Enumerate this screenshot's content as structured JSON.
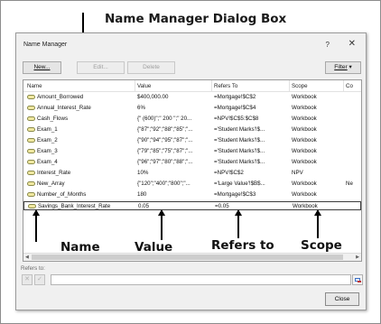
{
  "header_label": "Name Manager Dialog Box",
  "dialog": {
    "title": "Name Manager",
    "help_glyph": "?",
    "close_glyph": "✕",
    "buttons": {
      "new": "New...",
      "edit": "Edit...",
      "delete": "Delete",
      "filter": "Filter",
      "filter_caret": "▾"
    },
    "columns": [
      "Name",
      "Value",
      "Refers To",
      "Scope",
      "Co"
    ],
    "rows": [
      {
        "name": "Amount_Borrowed",
        "value": "$400,000.00",
        "refers_to": "=Mortgage!$C$2",
        "scope": "Workbook",
        "comment": ""
      },
      {
        "name": "Annual_Interest_Rate",
        "value": "6%",
        "refers_to": "=Mortgage!$C$4",
        "scope": "Workbook",
        "comment": ""
      },
      {
        "name": "Cash_Flows",
        "value": "{\" (600)\";\" 200 \";\" 20...",
        "refers_to": "=NPV!$C$5:$C$8",
        "scope": "Workbook",
        "comment": ""
      },
      {
        "name": "Exam_1",
        "value": "{\"87\";\"92\";\"88\";\"85\";\"...",
        "refers_to": "='Student Marks'!$...",
        "scope": "Workbook",
        "comment": ""
      },
      {
        "name": "Exam_2",
        "value": "{\"90\";\"94\";\"95\";\"87\";\"...",
        "refers_to": "='Student Marks'!$...",
        "scope": "Workbook",
        "comment": ""
      },
      {
        "name": "Exam_3",
        "value": "{\"79\";\"85\";\"75\";\"87\";\"...",
        "refers_to": "='Student Marks'!$...",
        "scope": "Workbook",
        "comment": ""
      },
      {
        "name": "Exam_4",
        "value": "{\"96\";\"97\";\"80\";\"88\";\"...",
        "refers_to": "='Student Marks'!$...",
        "scope": "Workbook",
        "comment": ""
      },
      {
        "name": "Interest_Rate",
        "value": "10%",
        "refers_to": "=NPV!$C$2",
        "scope": "NPV",
        "comment": ""
      },
      {
        "name": "New_Array",
        "value": "{\"120\";\"400\";\"800\";\"...",
        "refers_to": "='Large Value'!$B$...",
        "scope": "Workbook",
        "comment": "Ne"
      },
      {
        "name": "Number_of_Months",
        "value": "180",
        "refers_to": "=Mortgage!$C$3",
        "scope": "Workbook",
        "comment": ""
      },
      {
        "name": "Savings_Bank_Interest_Rate",
        "value": "0.05",
        "refers_to": "=0.05",
        "scope": "Workbook",
        "comment": "",
        "selected": true
      }
    ],
    "refers_label": "Refers to:",
    "refers_value": "",
    "cancel_glyph": "✕",
    "confirm_glyph": "✓",
    "close_label": "Close"
  },
  "annotations": {
    "name": "Name",
    "value": "Value",
    "refers_to": "Refers to",
    "scope": "Scope"
  }
}
